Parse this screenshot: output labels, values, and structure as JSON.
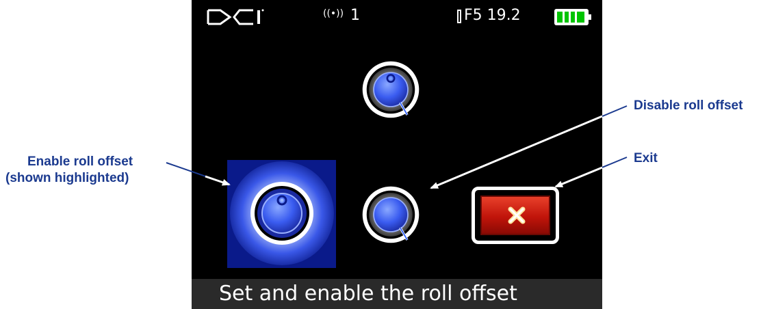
{
  "status_bar": {
    "logo_text": "DCI",
    "signal_icon": "antenna-signal-icon",
    "signal_channel": "1",
    "transmitter_icon": "transmitter-icon",
    "frequency_readout": "F5 19.2",
    "battery_icon": "battery-full-icon"
  },
  "menu": {
    "items": [
      {
        "name": "set-roll-offset",
        "icon": "roll-dial-icon"
      },
      {
        "name": "enable-roll-offset",
        "icon": "roll-dial-icon",
        "highlighted": true
      },
      {
        "name": "disable-roll-offset",
        "icon": "roll-dial-icon"
      },
      {
        "name": "exit",
        "icon": "close-x-icon"
      }
    ]
  },
  "footer": {
    "text": "Set and enable the roll offset"
  },
  "callouts": {
    "enable": "Enable roll offset",
    "enable_note": "(shown highlighted)",
    "disable": "Disable roll offset",
    "exit": "Exit"
  },
  "colors": {
    "callout_text": "#1b3a8f",
    "highlight_bg": "#0a1a8a",
    "exit_red": "#d42a14",
    "footer_bg": "#2a2a2a"
  }
}
